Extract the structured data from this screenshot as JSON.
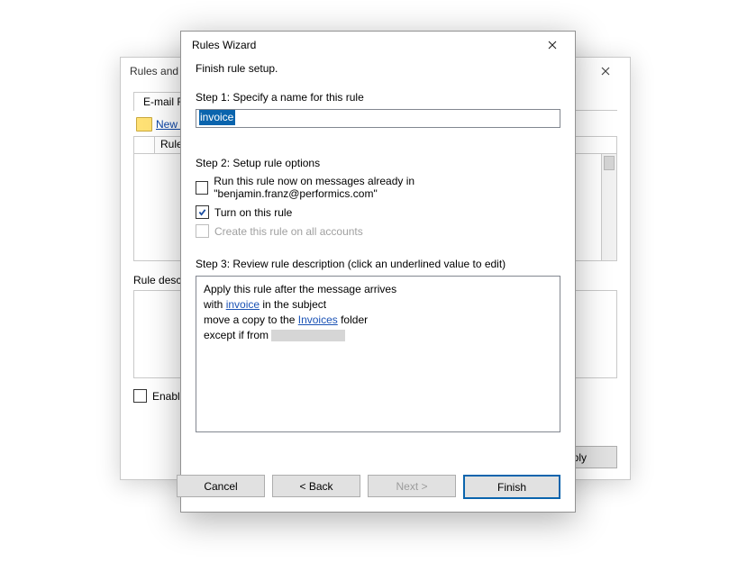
{
  "back": {
    "title": "Rules and A",
    "tab_label": "E-mail Rule",
    "toolbar_new": "New R",
    "rule_col_label": "Rule (",
    "desc_label": "Rule descr",
    "enable_label": "Enable",
    "apply_btn": "Apply"
  },
  "front": {
    "title": "Rules Wizard",
    "subtitle": "Finish rule setup.",
    "step1_label": "Step 1: Specify a name for this rule",
    "name_value": "invoice",
    "step2_label": "Step 2: Setup rule options",
    "opt_run_now_prefix": "Run this rule now on messages already in \"",
    "opt_run_now_account": "benjamin.franz@performics.com",
    "opt_run_now_suffix": "\"",
    "opt_turn_on": "Turn on this rule",
    "opt_all_accounts": "Create this rule on all accounts",
    "step3_label": "Step 3: Review rule description (click an underlined value to edit)",
    "desc_line1": "Apply this rule after the message arrives",
    "desc_line2_a": "with ",
    "desc_line2_link": "invoice",
    "desc_line2_b": " in the subject",
    "desc_line3_a": "move a copy to the ",
    "desc_line3_link": "Invoices",
    "desc_line3_b": " folder",
    "desc_line4_a": "except if from ",
    "btn_cancel": "Cancel",
    "btn_back": "<  Back",
    "btn_next": "Next  >",
    "btn_finish": "Finish"
  },
  "checkbox_states": {
    "run_now": false,
    "turn_on": true,
    "all_accounts": false,
    "enable_back": false
  }
}
